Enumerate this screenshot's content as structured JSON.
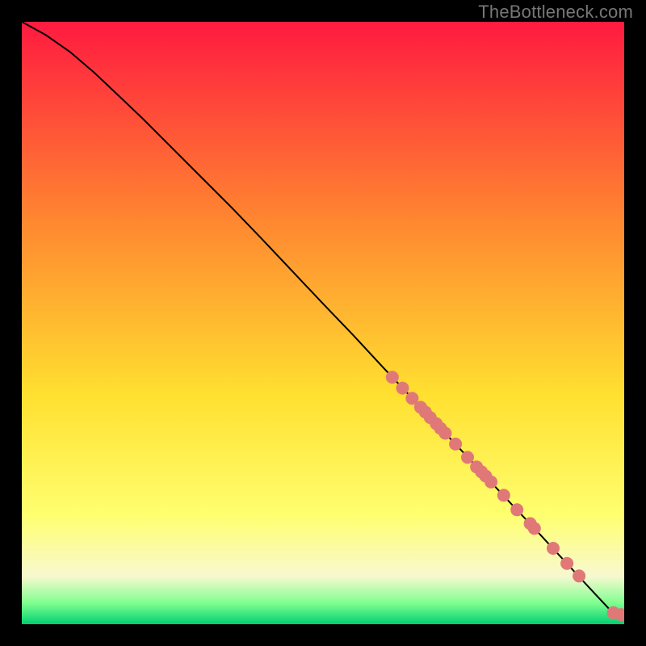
{
  "watermark": "TheBottleneck.com",
  "chart_data": {
    "type": "line",
    "title": "",
    "xlabel": "",
    "ylabel": "",
    "x_range": [
      0,
      100
    ],
    "y_range": [
      0,
      100
    ],
    "curve": {
      "x": [
        0,
        4,
        8,
        12,
        16,
        20,
        25,
        30,
        35,
        40,
        45,
        50,
        55,
        60,
        65,
        70,
        75,
        80,
        85,
        90,
        95,
        98,
        100
      ],
      "y": [
        100,
        97.8,
        95,
        91.6,
        87.8,
        84,
        79,
        74,
        69,
        63.8,
        58.5,
        53.2,
        48,
        42.6,
        37.3,
        32,
        26.7,
        21.3,
        16,
        10.6,
        5.2,
        2.0,
        1.3
      ]
    },
    "scatter_points": {
      "x": [
        61.5,
        63.2,
        64.8,
        66.2,
        67.0,
        67.8,
        68.8,
        69.5,
        70.3,
        72.0,
        74.0,
        75.5,
        76.3,
        77.0,
        77.9,
        80.0,
        82.2,
        84.4,
        85.1,
        88.2,
        90.5,
        92.5,
        98.2,
        99.5
      ],
      "y": [
        41.0,
        39.2,
        37.5,
        36.0,
        35.2,
        34.3,
        33.3,
        32.5,
        31.7,
        29.9,
        27.7,
        26.1,
        25.3,
        24.6,
        23.6,
        21.4,
        19.0,
        16.7,
        15.9,
        12.6,
        10.1,
        8.0,
        1.9,
        1.6
      ]
    },
    "point_color": "#e07878",
    "gradient_colors": {
      "top": "#ff1a40",
      "upper_mid": "#ff8a30",
      "mid": "#ffe030",
      "lower_mid": "#ffff70",
      "pale": "#f8f8d0",
      "green_light": "#80ff90",
      "green": "#00d070"
    }
  }
}
